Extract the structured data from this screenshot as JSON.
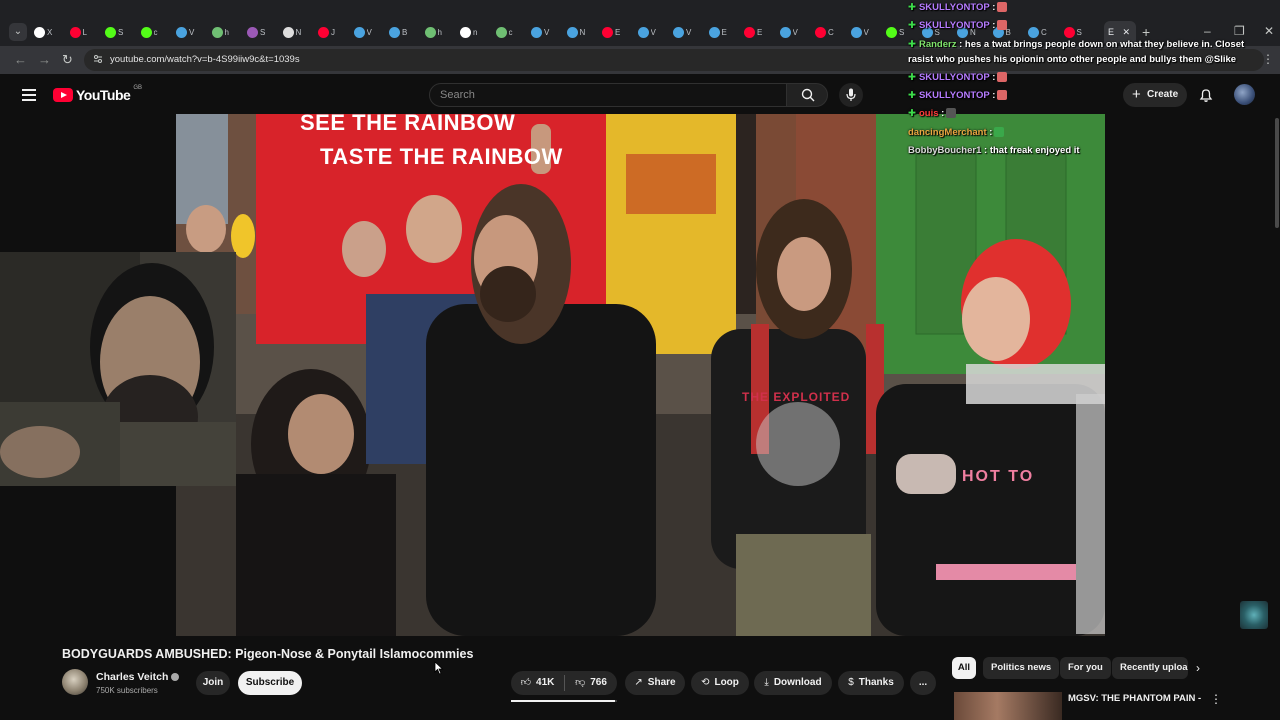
{
  "browser": {
    "tabs": [
      {
        "label": "X",
        "color": "#ffffff"
      },
      {
        "label": "L",
        "color": "#ff0033"
      },
      {
        "label": "S",
        "color": "#53fc18"
      },
      {
        "label": "c",
        "color": "#53fc18"
      },
      {
        "label": "V",
        "color": "#4aa3df"
      },
      {
        "label": "h",
        "color": "#6fbf73"
      },
      {
        "label": "S",
        "color": "#9b59b6"
      },
      {
        "label": "N",
        "color": "#dddddd"
      },
      {
        "label": "J",
        "color": "#ff0033"
      },
      {
        "label": "V",
        "color": "#4aa3df"
      },
      {
        "label": "B",
        "color": "#4aa3df"
      },
      {
        "label": "h",
        "color": "#6fbf73"
      },
      {
        "label": "n",
        "color": "#ffffff"
      },
      {
        "label": "c",
        "color": "#6fbf73"
      },
      {
        "label": "V",
        "color": "#4aa3df"
      },
      {
        "label": "N",
        "color": "#4aa3df"
      },
      {
        "label": "E",
        "color": "#ff0033"
      },
      {
        "label": "V",
        "color": "#4aa3df"
      },
      {
        "label": "V",
        "color": "#4aa3df"
      },
      {
        "label": "E",
        "color": "#4aa3df"
      },
      {
        "label": "E",
        "color": "#ff0033"
      },
      {
        "label": "V",
        "color": "#4aa3df"
      },
      {
        "label": "C",
        "color": "#ff0033"
      },
      {
        "label": "V",
        "color": "#4aa3df"
      },
      {
        "label": "S",
        "color": "#53fc18"
      },
      {
        "label": "S",
        "color": "#4aa3df"
      },
      {
        "label": "N",
        "color": "#4aa3df"
      },
      {
        "label": "B",
        "color": "#4aa3df"
      },
      {
        "label": "C",
        "color": "#4aa3df"
      },
      {
        "label": "S",
        "color": "#ff0033"
      }
    ],
    "active_tab": "E",
    "new_tab": "+",
    "url": "youtube.com/watch?v=b-4S99iiw9c&t=1039s"
  },
  "youtube": {
    "logo": "YouTube",
    "region": "GB",
    "search_placeholder": "Search",
    "create_label": "Create"
  },
  "chat": [
    {
      "user": "SKULLYONTOP",
      "text": ":",
      "user_color": "purple"
    },
    {
      "user": "SKULLYONTOP",
      "text": ":",
      "user_color": "purple"
    },
    {
      "user": "Randerz",
      "text": ": hes a twat brings people down on what they believe in. Closet",
      "user_color": "green"
    },
    {
      "user": "",
      "text": "rasist who pushes his opionin onto other people and bullys them @Slike",
      "user_color": "grey"
    },
    {
      "user": "SKULLYONTOP",
      "text": ":",
      "user_color": "purple"
    },
    {
      "user": "SKULLYONTOP",
      "text": ":",
      "user_color": "purple"
    },
    {
      "user": "ouis",
      "text": ":",
      "user_color": "red"
    },
    {
      "user": "dancingMerchant",
      "text": ":",
      "user_color": "orange"
    },
    {
      "user": "BobbyBoucher1",
      "text": ": that freak enjoyed it",
      "user_color": "grey"
    }
  ],
  "video": {
    "sign_line1": "SEE THE RAINBOW",
    "sign_line2": "TASTE THE RAINBOW",
    "shirt1": "THE EXPLOITED",
    "shirt2": "HOT TO"
  },
  "details": {
    "title": "BODYGUARDS AMBUSHED: Pigeon-Nose & Ponytail Islamocommies",
    "channel": "Charles Veitch",
    "subscribers": "750K subscribers",
    "join": "Join",
    "subscribe": "Subscribe",
    "likes": "41K",
    "dislikes": "766",
    "like_ratio": 0.98,
    "share": "Share",
    "loop": "Loop",
    "download": "Download",
    "thanks": "Thanks",
    "more": "..."
  },
  "sidebar": {
    "chips": [
      "All",
      "Politics news",
      "For you",
      "Recently uploaded"
    ],
    "recommended_title": "MGSV: THE PHANTOM PAIN -"
  }
}
